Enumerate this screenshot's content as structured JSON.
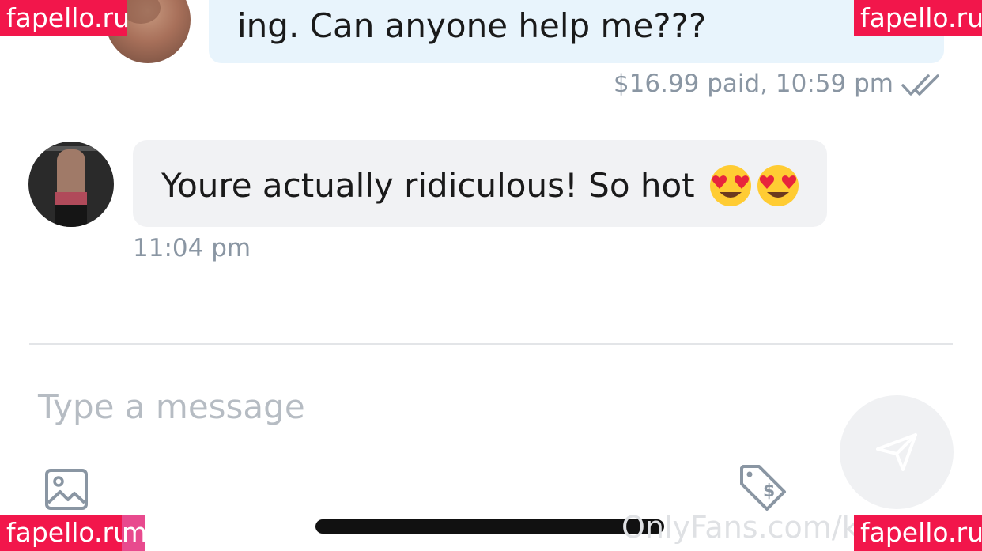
{
  "conversation": {
    "outgoing_message": {
      "text": "ing. Can anyone help me???",
      "meta": "$16.99 paid, 10:59 pm",
      "status_icon": "double-check-icon"
    },
    "incoming_message": {
      "text": "Youre actually ridiculous! So hot",
      "emojis": [
        "heart-eyes-emoji",
        "heart-eyes-emoji"
      ],
      "timestamp": "11:04 pm"
    }
  },
  "composer": {
    "placeholder": "Type a message",
    "send_icon": "send-icon",
    "media_icon": "image-icon",
    "price_icon": "price-tag-icon"
  },
  "footer": {
    "url": "OnlyFans.com/ke"
  },
  "watermarks": {
    "top_left": "fapello.ru",
    "top_right": "fapello.ru",
    "bottom_left": "fapello.ru",
    "bottom_left_tail": "m",
    "bottom_right": "fapello.ru"
  },
  "colors": {
    "outgoing_bubble": "#e8f4fc",
    "incoming_bubble": "#f1f2f4",
    "meta_text": "#8a96a3",
    "watermark": "#f2164b"
  }
}
